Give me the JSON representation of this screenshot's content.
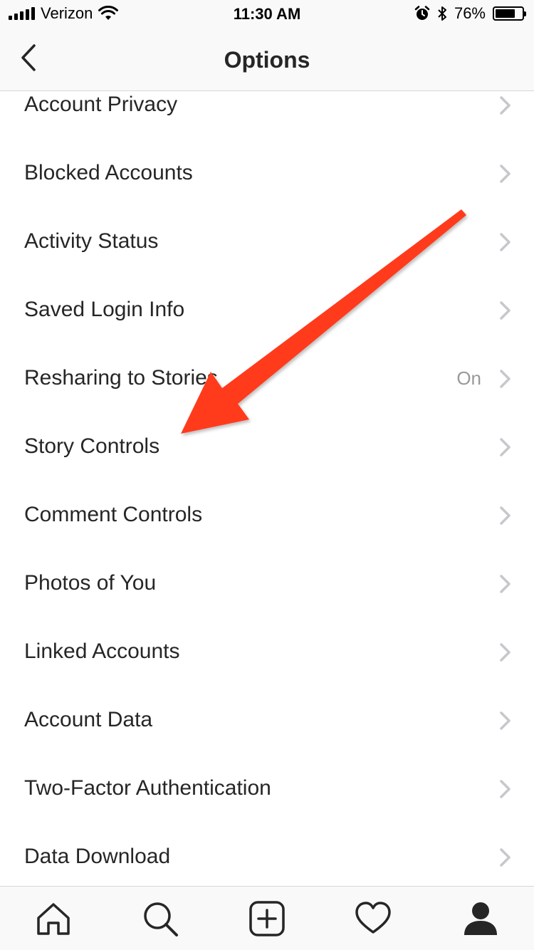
{
  "status_bar": {
    "carrier": "Verizon",
    "time": "11:30 AM",
    "battery_percent": "76%",
    "battery_level": 0.76,
    "icons": [
      "signal-icon",
      "wifi-icon",
      "alarm-icon",
      "bluetooth-icon",
      "battery-icon"
    ]
  },
  "nav": {
    "title": "Options",
    "back_icon": "chevron-left-icon"
  },
  "options": [
    {
      "label": "Account Privacy",
      "value": ""
    },
    {
      "label": "Blocked Accounts",
      "value": ""
    },
    {
      "label": "Activity Status",
      "value": ""
    },
    {
      "label": "Saved Login Info",
      "value": ""
    },
    {
      "label": "Resharing to Stories",
      "value": "On"
    },
    {
      "label": "Story Controls",
      "value": ""
    },
    {
      "label": "Comment Controls",
      "value": ""
    },
    {
      "label": "Photos of You",
      "value": ""
    },
    {
      "label": "Linked Accounts",
      "value": ""
    },
    {
      "label": "Account Data",
      "value": ""
    },
    {
      "label": "Two-Factor Authentication",
      "value": ""
    },
    {
      "label": "Data Download",
      "value": ""
    }
  ],
  "tab_bar": {
    "tabs": [
      "home-icon",
      "search-icon",
      "add-post-icon",
      "heart-icon",
      "profile-icon"
    ],
    "active": "profile-icon"
  },
  "annotation": {
    "type": "arrow",
    "color": "#ff3b1f",
    "points_to": "Story Controls"
  },
  "colors": {
    "text": "#262626",
    "secondary_text": "#999999",
    "chevron": "#c7c7cc",
    "bar_background": "#f9f9f9"
  }
}
